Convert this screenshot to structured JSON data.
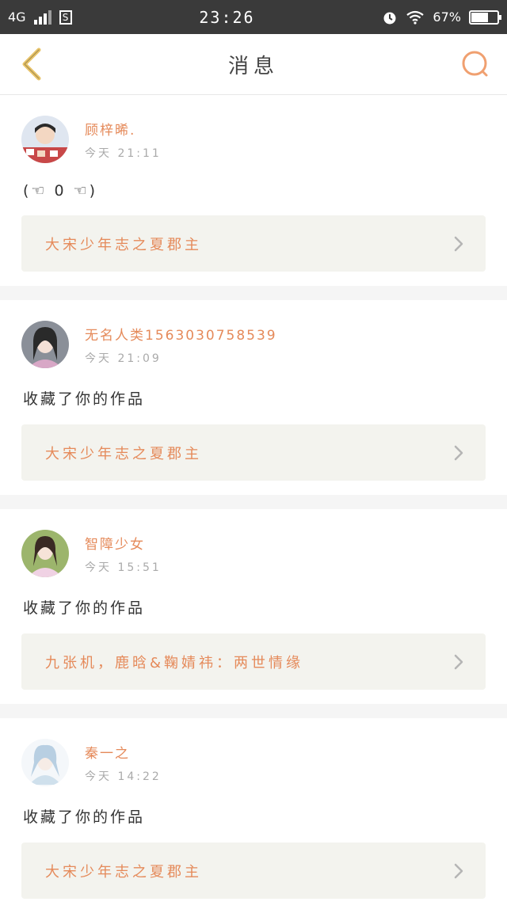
{
  "status_bar": {
    "network": "4G",
    "sim_label": "S",
    "time": "23:26",
    "battery_percent": "67%",
    "battery_level": 0.67
  },
  "header": {
    "title": "消息"
  },
  "colors": {
    "accent": "#e58a5a",
    "back_icon": "#e8c46a",
    "search_icon": "#f0a070",
    "link_bg": "#f3f3ee"
  },
  "messages": [
    {
      "username": "顾梓晞.",
      "time": "今天 21:11",
      "content": "(☜ 0 ☜)",
      "work_title": "大宋少年志之夏郡主",
      "avatar_icon": "avatar-photo"
    },
    {
      "username": "无名人类15630307585​39",
      "time": "今天 21:09",
      "content": "收藏了你的作品",
      "work_title": "大宋少年志之夏郡主",
      "avatar_icon": "avatar-photo"
    },
    {
      "username": "智障少女",
      "time": "今天 15:51",
      "content": "收藏了你的作品",
      "work_title": "九张机，鹿晗&鞠婧祎：两世情缘",
      "avatar_icon": "avatar-photo"
    },
    {
      "username": "秦一之",
      "time": "今天 14:22",
      "content": "收藏了你的作品",
      "work_title": "大宋少年志之夏郡主",
      "avatar_icon": "avatar-photo"
    }
  ]
}
